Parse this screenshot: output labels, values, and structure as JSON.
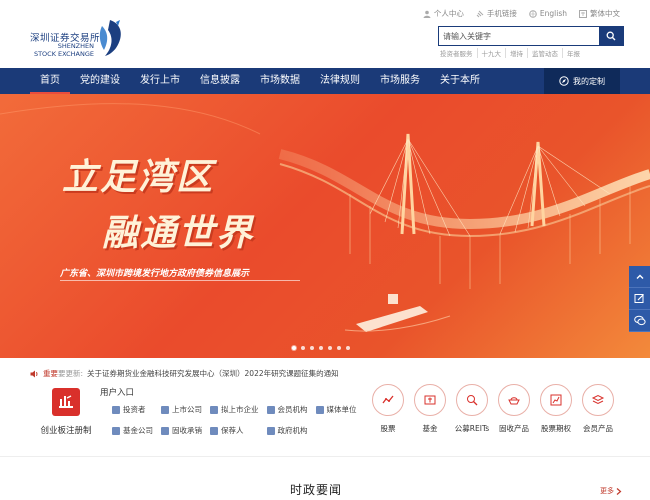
{
  "header": {
    "logo_cn": "深圳证券交易所",
    "logo_en_line1": "SHENZHEN",
    "logo_en_line2": "STOCK EXCHANGE",
    "top_links": [
      "个人中心",
      "手机链接",
      "English",
      "繁体中文"
    ],
    "search_placeholder": "请输入关键字",
    "hot_words": [
      "投资者服务",
      "十九大",
      "增持",
      "监管动态",
      "年报"
    ]
  },
  "nav": {
    "items": [
      "首页",
      "党的建设",
      "发行上市",
      "信息披露",
      "市场数据",
      "法律规则",
      "市场服务",
      "关于本所"
    ],
    "active_index": 0,
    "custom_label": "我的定制"
  },
  "banner": {
    "title_line1": "立足湾区",
    "title_line2": "融通世界",
    "subtitle": "广东省、深圳市跨境发行地方政府债券信息展示",
    "slide_count": 7,
    "active_slide": 0
  },
  "notice": {
    "label": "重要",
    "label2": "要更新:",
    "text": "关于证券期货业金融科技研究发展中心（深圳）2022年研究课题征集的通知"
  },
  "gem": {
    "label": "创业板注册制"
  },
  "user_entry": {
    "title": "用户入口",
    "items": [
      "投资者",
      "上市公司",
      "拟上市企业",
      "会员机构",
      "媒体单位",
      "基金公司",
      "固收承销",
      "保荐人",
      "政府机构"
    ]
  },
  "products": [
    {
      "label": "股票",
      "icon": "chart-icon"
    },
    {
      "label": "基金",
      "icon": "fund-icon"
    },
    {
      "label": "公募REITs",
      "icon": "reits-icon"
    },
    {
      "label": "固收产品",
      "icon": "bond-icon"
    },
    {
      "label": "股票期权",
      "icon": "option-icon"
    },
    {
      "label": "会员产品",
      "icon": "layers-icon"
    }
  ],
  "news": {
    "title": "时政要闻",
    "more": "更多"
  },
  "colors": {
    "nav_bg": "#1b3a78",
    "brand_red": "#d9302b",
    "banner_orange": "#ea4b2c"
  }
}
